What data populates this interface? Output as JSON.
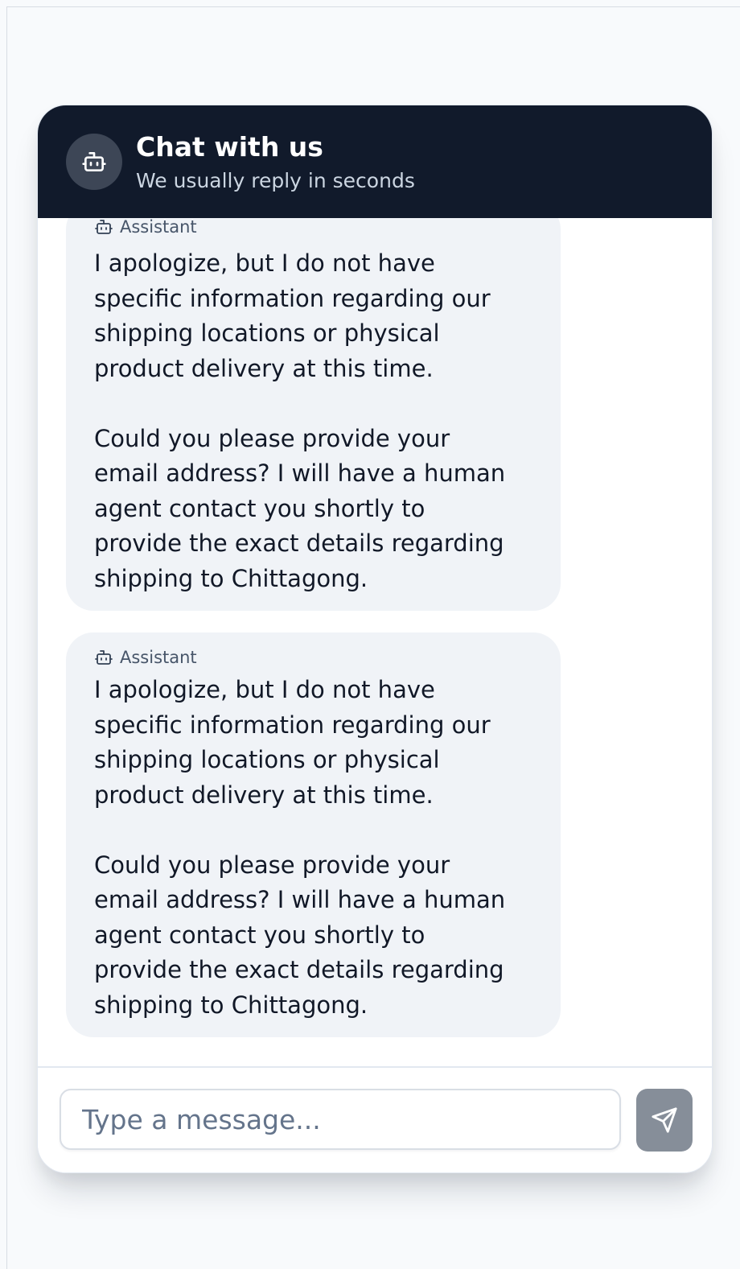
{
  "header": {
    "title": "Chat with us",
    "subtitle": "We usually reply in seconds",
    "avatar_icon": "bot-icon"
  },
  "messages": [
    {
      "sender": "Assistant",
      "sender_icon": "bot-icon",
      "text": "I apologize, but I do not have\nspecific information regarding our\nshipping locations or physical\nproduct delivery at this time.\n\nCould you please provide your\nemail address? I will have a human\nagent contact you shortly to\nprovide the exact details regarding\nshipping to Chittagong."
    },
    {
      "sender": "Assistant",
      "sender_icon": "bot-icon",
      "text": "I apologize, but I do not have\nspecific information regarding our\nshipping locations or physical\nproduct delivery at this time.\n\nCould you please provide your\nemail address? I will have a human\nagent contact you shortly to\nprovide the exact details regarding\nshipping to Chittagong."
    }
  ],
  "composer": {
    "placeholder": "Type a message...",
    "value": "",
    "send_icon": "send-icon"
  },
  "colors": {
    "header_bg": "#111a2b",
    "bubble_bg": "#f0f3f7",
    "send_button_bg": "#868e99",
    "page_bg": "#f8fafc"
  }
}
